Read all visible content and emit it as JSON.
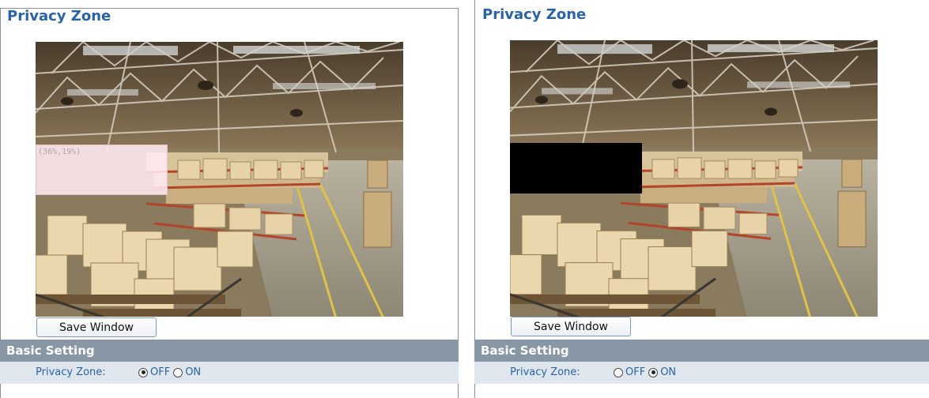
{
  "panels": [
    {
      "title": "Privacy Zone",
      "zone_overlay": {
        "coords_label": "(36%,19%)",
        "style": "translucent-pink"
      },
      "save_button_label": "Save Window",
      "section_title": "Basic Setting",
      "field_label": "Privacy Zone:",
      "options": [
        {
          "label": "OFF",
          "selected": true
        },
        {
          "label": "ON",
          "selected": false
        }
      ]
    },
    {
      "title": "Privacy Zone",
      "zone_overlay": {
        "style": "black-mask"
      },
      "save_button_label": "Save Window",
      "section_title": "Basic Setting",
      "field_label": "Privacy Zone:",
      "options": [
        {
          "label": "OFF",
          "selected": false
        },
        {
          "label": "ON",
          "selected": true
        }
      ]
    }
  ],
  "colors": {
    "title": "#2a64a6",
    "section_bar": "#8897a6",
    "section_row": "#dfe6ed",
    "mask": "#000000",
    "button_border": "#7a9bbe"
  }
}
